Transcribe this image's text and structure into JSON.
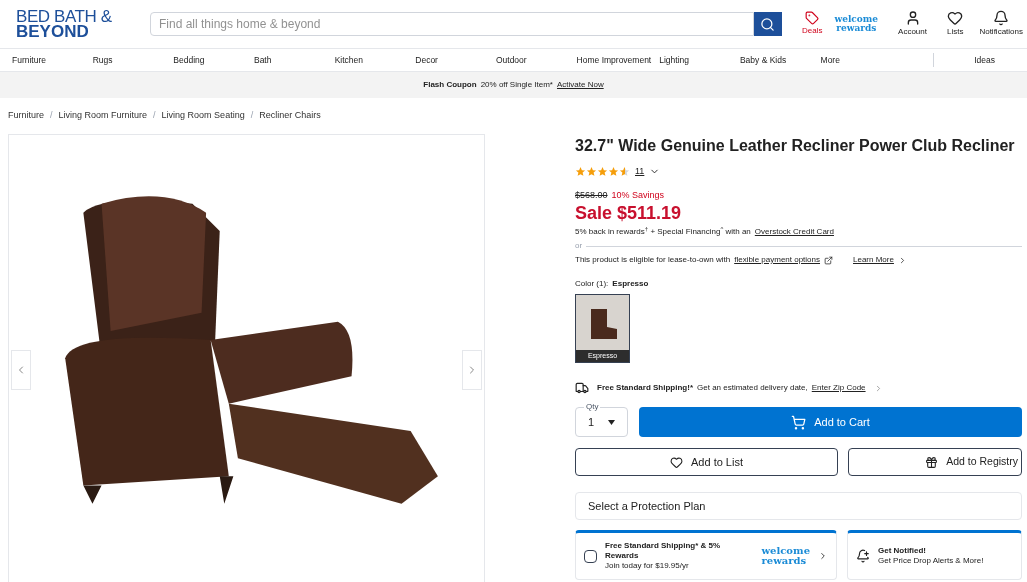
{
  "header": {
    "logo_line_1": "BED BATH &",
    "logo_line_2": "BEYOND",
    "search": {
      "placeholder": "Find all things home & beyond"
    },
    "deals": "Deals",
    "rewards_line_1": "welcome",
    "rewards_line_2": "rewards",
    "account": "Account",
    "lists": "Lists",
    "notifications": "Notifications"
  },
  "nav": [
    "Furniture",
    "Rugs",
    "Bedding",
    "Bath",
    "Kitchen",
    "Decor",
    "Outdoor",
    "Home Improvement",
    "Lighting",
    "Baby & Kids",
    "More",
    "Ideas"
  ],
  "promo": {
    "title": "Flash Coupon",
    "text": "20% off Single Item*",
    "link": "Activate Now"
  },
  "breadcrumb_separator": "/",
  "breadcrumbs": [
    "Furniture",
    "Living Room Furniture",
    "Living Room Seating",
    "Recliner Chairs"
  ],
  "product": {
    "title": "32.7\" Wide Genuine Leather Recliner Power Club Recliner",
    "stars": 4.5,
    "review_count": "11",
    "original_price": "$568.00",
    "savings": "10% Savings",
    "sale_price": "Sale $511.19",
    "financing": "5% back in rewards$^{†}$ + Special Financing$^{^}$ with an",
    "financing_link": "Overstock Credit Card",
    "or": "or",
    "lease": "This product is eligible for lease-to-own with",
    "lease_link": "flexible payment options",
    "learn_more": "Learn More",
    "color_label": "Color (1):",
    "color_value": "Espresso",
    "swatches": [
      {
        "label": "Espresso",
        "selected": true
      }
    ],
    "shipping_bold": "Free Standard Shipping!*",
    "shipping_text": "Get an estimated delivery date,",
    "shipping_link": "Enter Zip Code",
    "qty_label": "Qty",
    "qty_value": "1",
    "add_to_cart": "Add to Cart",
    "add_to_list": "Add to List",
    "add_to_registry": "Add to Registry",
    "protection_plan": "Select a Protection Plan",
    "rewards_card": {
      "checked": false,
      "title": "Free Standard Shipping* & 5% Rewards",
      "subtitle": "Join today for $19.95/yr",
      "logo_line_1": "welcome",
      "logo_line_2": "rewards"
    },
    "notify_card": {
      "title": "Get Notified!",
      "subtitle": "Get Price Drop Alerts & More!"
    }
  }
}
